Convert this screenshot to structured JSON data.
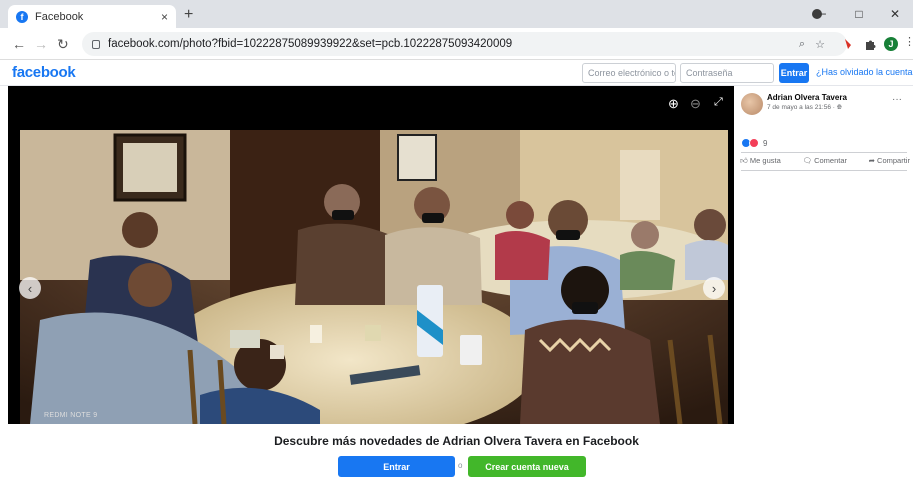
{
  "browser": {
    "tab_title": "Facebook",
    "tab_close": "×",
    "new_tab": "+",
    "url": "facebook.com/photo?fbid=10222875089939922&set=pcb.10222875093420009",
    "profile_initial": "J",
    "window_controls": [
      "−",
      "□",
      "✕"
    ]
  },
  "header": {
    "logo": "facebook",
    "email_placeholder": "Correo electrónico o telé",
    "password_placeholder": "Contraseña",
    "login_button": "Entrar",
    "forgot_link": "¿Has olvidado la cuenta?"
  },
  "photo_viewer": {
    "watermark": "REDMI NOTE 9"
  },
  "post": {
    "author": "Adrian Olvera Tavera",
    "date": "7 de mayo a las 21:56 · ",
    "reaction_count": "9",
    "actions": {
      "like": "Me gusta",
      "comment": "Comentar",
      "share": "Compartir"
    }
  },
  "footer": {
    "title": "Descubre más novedades de Adrian Olvera Tavera en Facebook",
    "login_button": "Entrar",
    "separator": "o",
    "create_button": "Crear cuenta nueva"
  },
  "colors": {
    "brand": "#1877f2",
    "create": "#42b72a"
  }
}
